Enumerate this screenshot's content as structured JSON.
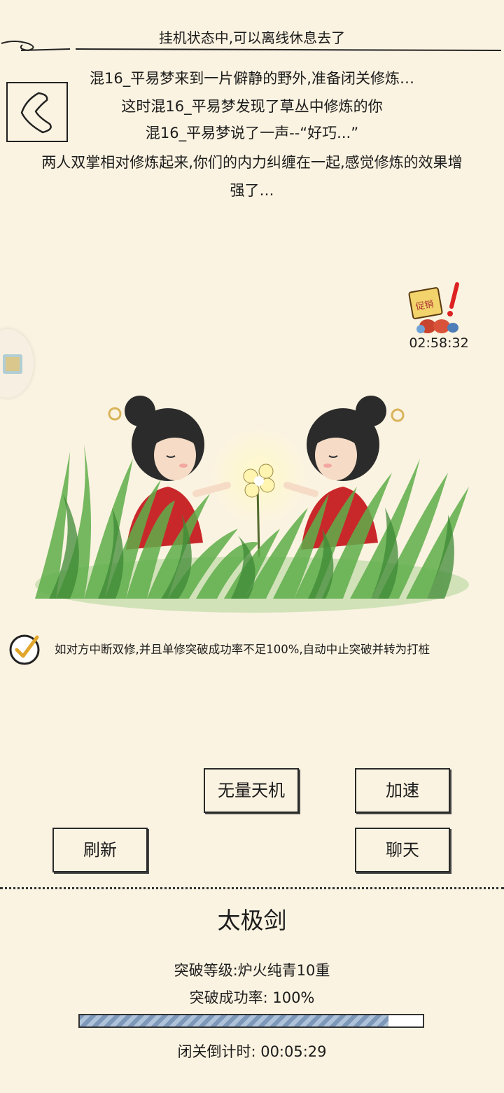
{
  "header": {
    "title": "挂机状态中,可以离线休息去了"
  },
  "story": {
    "lines": [
      "混16_平易梦来到一片僻静的野外,准备闭关修炼…",
      "这时混16_平易梦发现了草丛中修炼的你",
      "混16_平易梦说了一声--“好巧...”",
      "两人双掌相对修炼起来,你们的内力纠缠在一起,感觉修炼的效果增",
      "强了…"
    ]
  },
  "promo": {
    "icon": "promo-sale-icon",
    "sign_text": "促销",
    "timer": "02:58:32"
  },
  "auto_option": {
    "checked": true,
    "label": "如对方中断双修,并且单修突破成功率不足100%,自动中止突破并转为打桩"
  },
  "buttons": {
    "wuliang": "无量天机",
    "speed": "加速",
    "refresh": "刷新",
    "chat": "聊天"
  },
  "cultivation": {
    "skill_name": "太极剑",
    "level_text": "突破等级:炉火纯青10重",
    "success_rate_text": "突破成功率: 100%",
    "progress": 0.9,
    "countdown_text": "闭关倒计时: 00:05:29"
  }
}
